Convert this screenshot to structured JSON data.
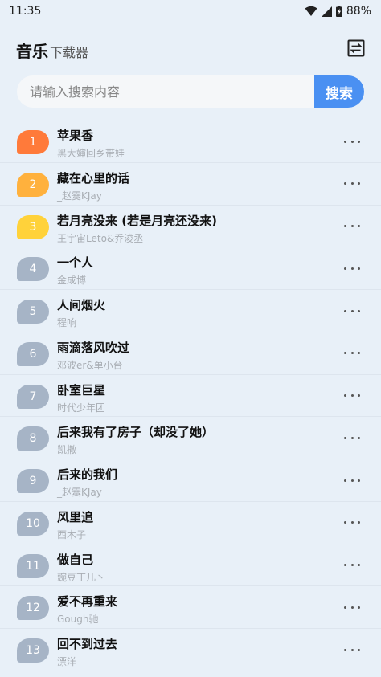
{
  "status_bar": {
    "time": "11:35",
    "battery": "88%",
    "icons": [
      "wifi-icon",
      "signal-icon",
      "battery-charging-icon"
    ]
  },
  "header": {
    "title": "音乐",
    "subtitle": "下载器",
    "switch_icon": "switch-icon"
  },
  "search": {
    "placeholder": "请输入搜索内容",
    "value": "",
    "button_label": "搜索",
    "button_color": "#4a90f2"
  },
  "colors": {
    "rank1": "#ff7a3a",
    "rank2": "#ffb13d",
    "rank3": "#ffd23a",
    "rank_default": "#a6b4c6"
  },
  "songs": [
    {
      "rank": "1",
      "title": "苹果香",
      "artist": "黑大婶回乡带娃"
    },
    {
      "rank": "2",
      "title": "藏在心里的话",
      "artist": "_赵霙KJay"
    },
    {
      "rank": "3",
      "title": "若月亮没来 (若是月亮还没来)",
      "artist": "王宇宙Leto&乔浚丞"
    },
    {
      "rank": "4",
      "title": "一个人",
      "artist": "金成博"
    },
    {
      "rank": "5",
      "title": "人间烟火",
      "artist": "程响"
    },
    {
      "rank": "6",
      "title": "雨滴落风吹过",
      "artist": "邓波er&单小台"
    },
    {
      "rank": "7",
      "title": "卧室巨星",
      "artist": "时代少年团"
    },
    {
      "rank": "8",
      "title": "后来我有了房子（却没了她）",
      "artist": "凯撒"
    },
    {
      "rank": "9",
      "title": "后来的我们",
      "artist": "_赵霙KJay"
    },
    {
      "rank": "10",
      "title": "风里追",
      "artist": "西木子"
    },
    {
      "rank": "11",
      "title": "做自己",
      "artist": "豌豆丁儿丶"
    },
    {
      "rank": "12",
      "title": "爱不再重来",
      "artist": "Gough驰"
    },
    {
      "rank": "13",
      "title": "回不到过去",
      "artist": "漂洋"
    }
  ]
}
